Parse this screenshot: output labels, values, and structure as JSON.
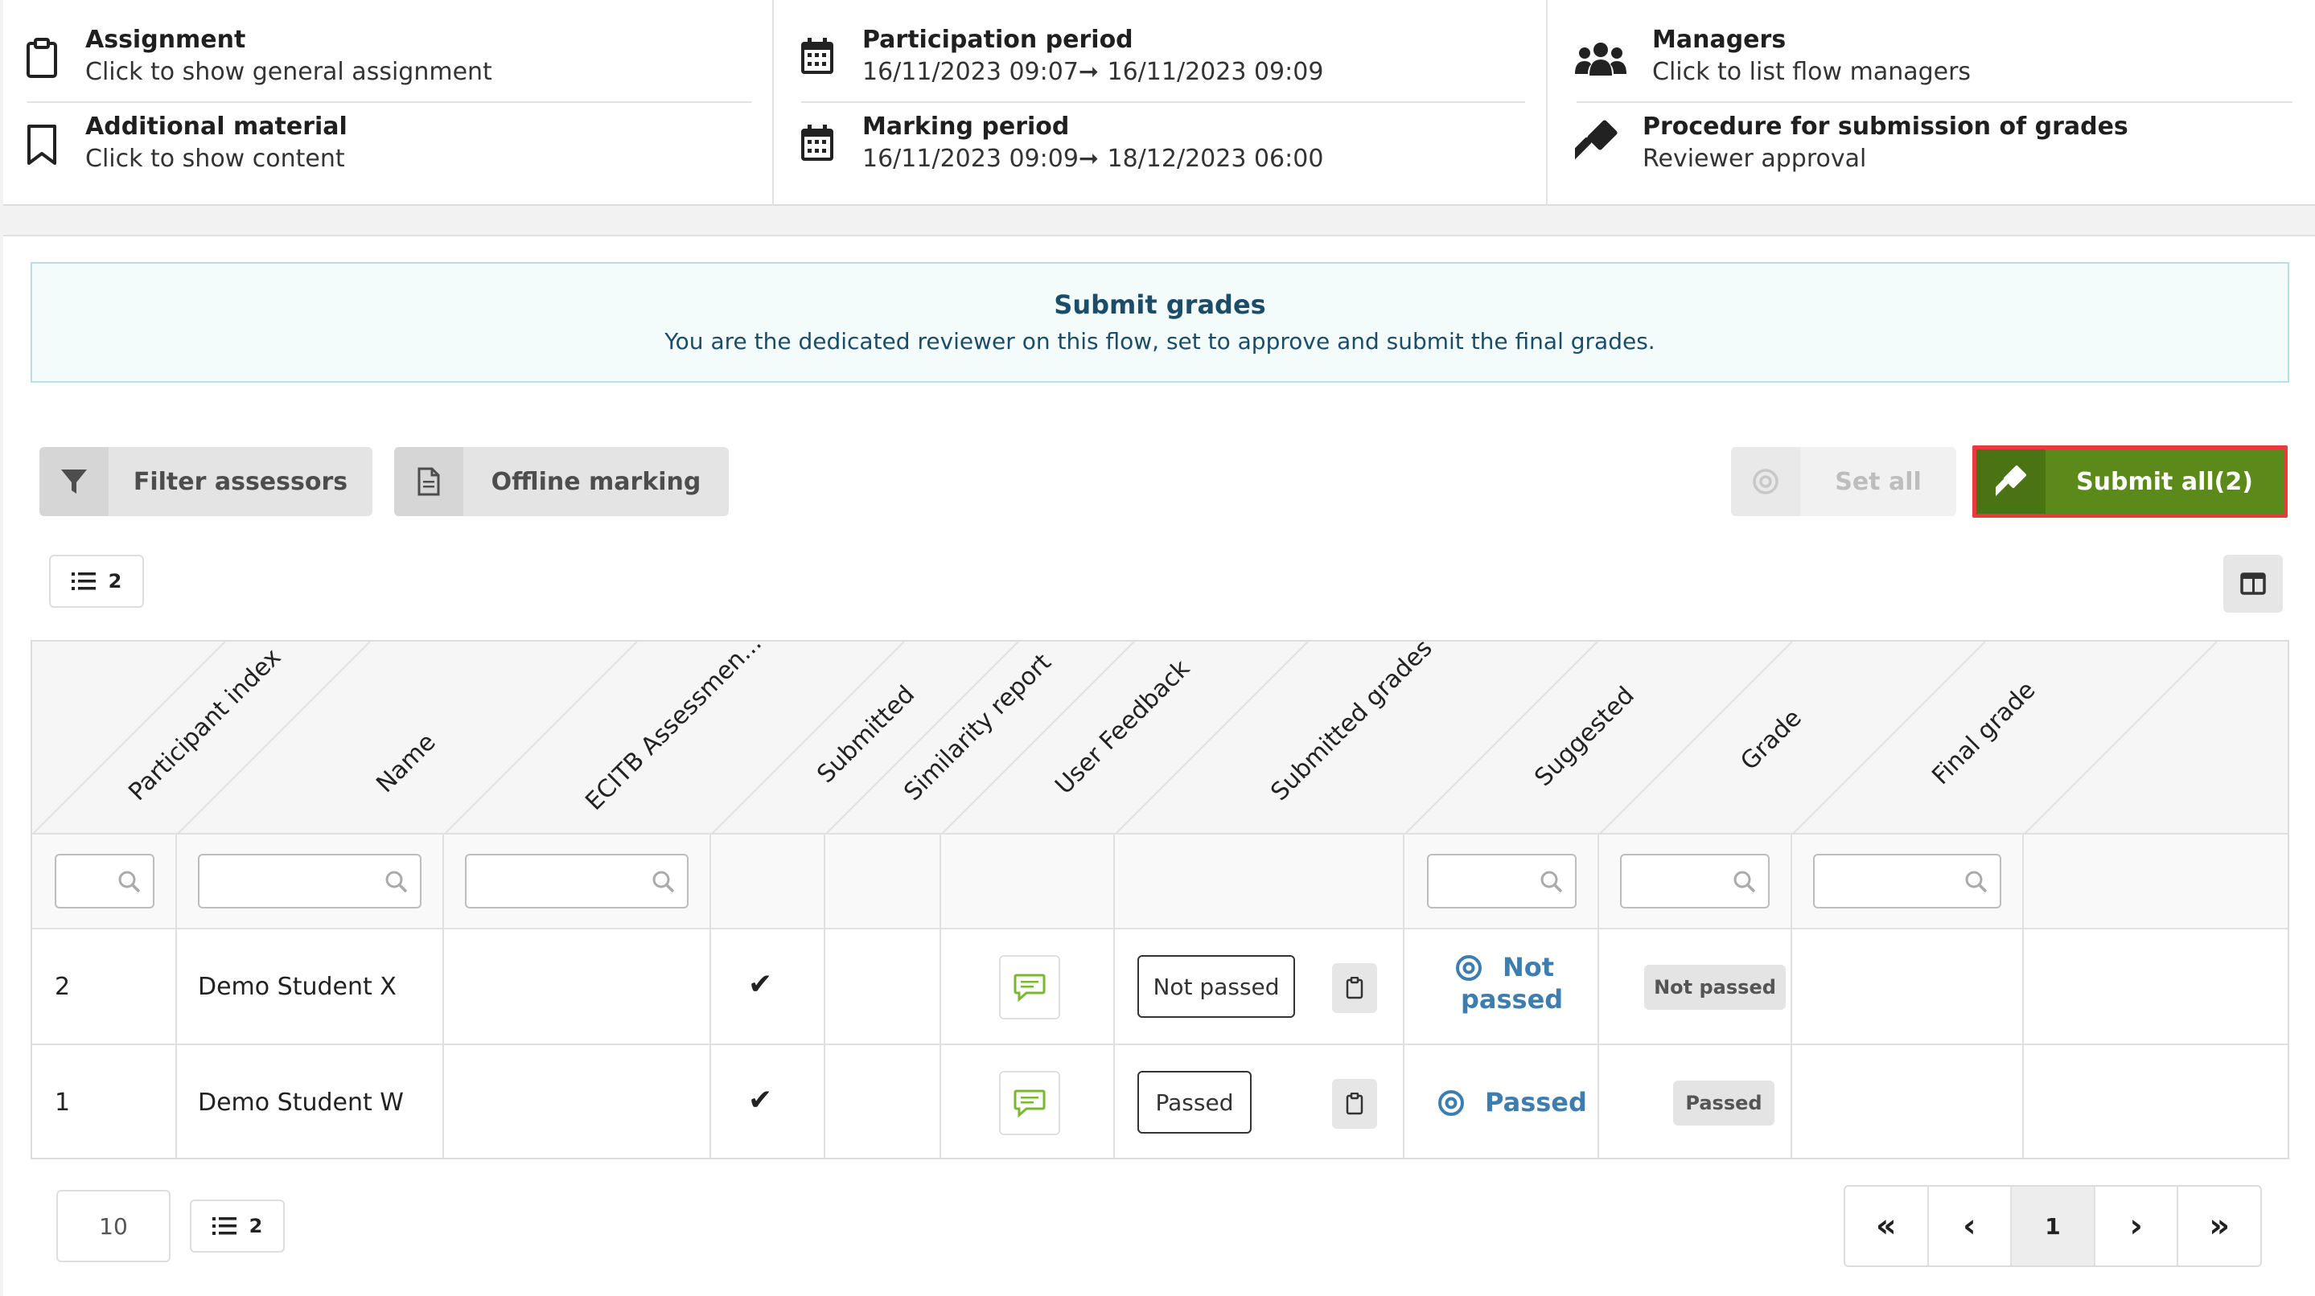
{
  "info": {
    "assignment": {
      "title": "Assignment",
      "subtitle": "Click to show general assignment"
    },
    "additional": {
      "title": "Additional material",
      "subtitle": "Click to show content"
    },
    "participation": {
      "title": "Participation period",
      "start": "16/11/2023 09:07",
      "end": "16/11/2023 09:09"
    },
    "marking": {
      "title": "Marking period",
      "start": "16/11/2023 09:09",
      "end": "18/12/2023 06:00"
    },
    "managers": {
      "title": "Managers",
      "subtitle": "Click to list flow managers"
    },
    "procedure": {
      "title": "Procedure for submission of grades",
      "subtitle": "Reviewer approval"
    }
  },
  "banner": {
    "title": "Submit grades",
    "text": "You are the dedicated reviewer on this flow, set to approve and submit the final grades."
  },
  "toolbar": {
    "filter_label": "Filter assessors",
    "offline_label": "Offline marking",
    "set_all_label": "Set all",
    "submit_all_label": "Submit all(2)",
    "list_count": "2"
  },
  "table": {
    "columns": [
      "Participant index",
      "Name",
      "ECITB Assessmen...",
      "Submitted",
      "Similarity report",
      "User Feedback",
      "Submitted grades",
      "Suggested",
      "Grade",
      "Final grade"
    ],
    "rows": [
      {
        "index": "2",
        "name": "Demo Student X",
        "submitted": "✔",
        "submitted_grade": "Not passed",
        "suggested_line1": "Not",
        "suggested_line2": "passed",
        "grade": "Not passed",
        "final_grade": ""
      },
      {
        "index": "1",
        "name": "Demo Student W",
        "submitted": "✔",
        "submitted_grade": "Passed",
        "suggested_line1": "Passed",
        "suggested_line2": "",
        "grade": "Passed",
        "final_grade": ""
      }
    ]
  },
  "footer": {
    "page_size": "10",
    "list_count": "2",
    "pagination": {
      "first": "«",
      "prev": "‹",
      "current": "1",
      "next": "›",
      "last": "»"
    }
  },
  "colors": {
    "accent_green": "#5c8a1a",
    "highlight_red": "#e8393d",
    "link_blue": "#3d7db0",
    "banner_bg": "#f3fbfb"
  }
}
